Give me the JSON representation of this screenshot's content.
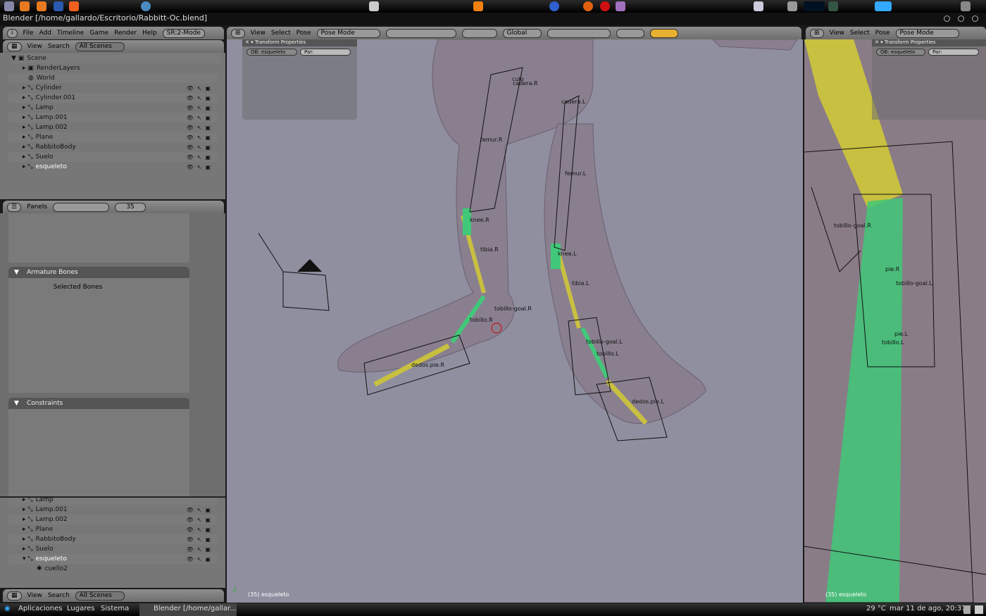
{
  "window": {
    "title": "Blender [/home/gallardo/Escritorio/Rabbitt-Oc.blend]"
  },
  "info_header": {
    "menus": [
      "File",
      "Add",
      "Timeline",
      "Game",
      "Render",
      "Help"
    ],
    "screen": "SR:2-Mode"
  },
  "outliner": {
    "menus": [
      "View",
      "Search"
    ],
    "scene_select": "All Scenes",
    "root": "Scene",
    "items": [
      {
        "label": "RenderLayers"
      },
      {
        "label": "World"
      },
      {
        "label": "Cylinder"
      },
      {
        "label": "Cylinder.001"
      },
      {
        "label": "Lamp"
      },
      {
        "label": "Lamp.001"
      },
      {
        "label": "Lamp.002"
      },
      {
        "label": "Plane"
      },
      {
        "label": "RabbitoBody"
      },
      {
        "label": "Suelo"
      },
      {
        "label": "esqueleto"
      }
    ]
  },
  "buttons": {
    "menu": "Panels",
    "frame": "35",
    "panels": [
      {
        "title": "Armature Bones",
        "content": "Selected Bones"
      },
      {
        "title": "Constraints"
      }
    ]
  },
  "outliner2": {
    "menus": [
      "View",
      "Search"
    ],
    "scene_select": "All Scenes",
    "items": [
      {
        "label": "Lamp"
      },
      {
        "label": "Lamp.001"
      },
      {
        "label": "Lamp.002"
      },
      {
        "label": "Plane"
      },
      {
        "label": "RabbitoBody"
      },
      {
        "label": "Suelo"
      },
      {
        "label": "esqueleto"
      },
      {
        "label": "cuello2"
      }
    ]
  },
  "viewport": {
    "menus": [
      "View",
      "Select",
      "Pose"
    ],
    "mode": "Pose Mode",
    "orientation": "Global",
    "transform": {
      "title": "Transform Properties",
      "ob": "OB: esqueleto",
      "par": "Par:"
    },
    "status": "(35) esqueleto",
    "bones": [
      "culo",
      "cadera.R",
      "cadera.L",
      "femur.R",
      "femur.L",
      "knee.R",
      "knee.L",
      "tibia.R",
      "tibia.L",
      "tobillo-goal.R",
      "tobillo-goal.L",
      "tobillo.R",
      "tobillo.L",
      "dedos.pie.R",
      "dedos.pie.L"
    ]
  },
  "viewport2": {
    "menus": [
      "View",
      "Select",
      "Pose"
    ],
    "mode": "Pose Mode",
    "transform": {
      "title": "Transform Properties",
      "ob": "OB: esqueleto",
      "par": "Par:"
    },
    "status": "(35) esqueleto",
    "bones": [
      "tobillo-goal.R",
      "pie.R",
      "tobillo-goal.L",
      "pie.L",
      "tobillo.L"
    ]
  },
  "taskbar": {
    "menus": [
      "Aplicaciones",
      "Lugares",
      "Sistema"
    ],
    "task": "Blender [/home/gallar...",
    "weather": "29 °C",
    "clock": "mar 11 de ago, 20:37"
  },
  "colors": {
    "viewport_bg": "#8f8fa0",
    "mesh": "#8c8090",
    "bone_yellow": "#c8c040",
    "bone_green": "#40c878"
  }
}
